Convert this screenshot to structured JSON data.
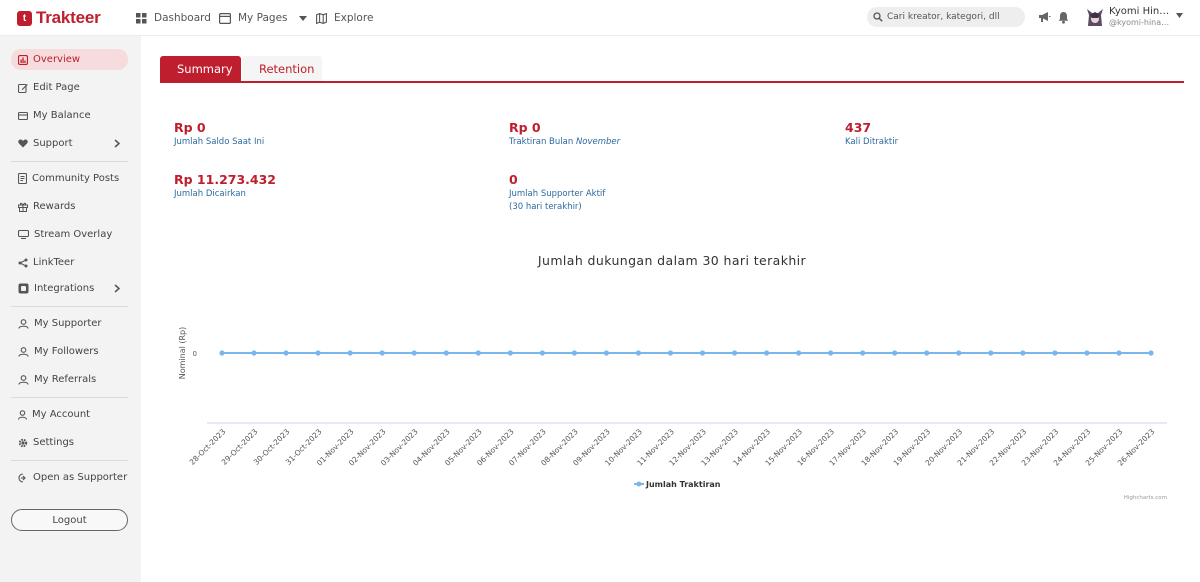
{
  "brand": {
    "name": "Trakteer",
    "color": "#be1e2d"
  },
  "topnav": {
    "dashboard": "Dashboard",
    "my_pages": "My Pages",
    "explore": "Explore",
    "search_placeholder": "Cari kreator, kategori, dll",
    "icons": [
      "megaphone-icon",
      "bell-icon"
    ],
    "user": {
      "name": "Kyomi Hinaga",
      "handle": "@kyomi-hinaga"
    }
  },
  "sidebar": {
    "items": [
      {
        "label": "Overview",
        "icon": "chart-bar-icon",
        "active": true
      },
      {
        "label": "Edit Page",
        "icon": "edit-icon"
      },
      {
        "label": "My Balance",
        "icon": "wallet-icon"
      },
      {
        "label": "Support",
        "icon": "heart-icon",
        "chevron": true
      },
      {
        "label": "Community Posts",
        "icon": "document-icon"
      },
      {
        "label": "Rewards",
        "icon": "gift-icon"
      },
      {
        "label": "Stream Overlay",
        "icon": "overlay-icon"
      },
      {
        "label": "LinkTeer",
        "icon": "share-icon"
      },
      {
        "label": "Integrations",
        "icon": "integrations-icon",
        "chevron": true
      },
      {
        "label": "My Supporter",
        "icon": "users-icon"
      },
      {
        "label": "My Followers",
        "icon": "users-icon"
      },
      {
        "label": "My Referrals",
        "icon": "users-icon"
      },
      {
        "label": "My Account",
        "icon": "user-icon"
      },
      {
        "label": "Settings",
        "icon": "gear-icon"
      },
      {
        "label": "Open as Supporter",
        "icon": "switch-icon"
      }
    ],
    "logout": "Logout"
  },
  "tabs": {
    "summary": "Summary",
    "retention": "Retention"
  },
  "stats": {
    "saldo": {
      "value": "Rp 0",
      "label": "Jumlah Saldo Saat Ini"
    },
    "traktiran": {
      "value": "Rp 0",
      "label": "Traktiran Bulan",
      "month": "November"
    },
    "ditraktir": {
      "value": "437",
      "label": "Kali Ditraktir"
    },
    "dicairkan": {
      "value": "Rp 11.273.432",
      "label": "Jumlah Dicairkan"
    },
    "supporter": {
      "value": "0",
      "label": "Jumlah Supporter Aktif",
      "sublabel": "(30 hari terakhir)"
    }
  },
  "chart_data": {
    "type": "line",
    "title": "Jumlah dukungan dalam 30 hari terakhir",
    "ylabel": "Nominal (Rp)",
    "xlabel": "",
    "yticks": [
      "0"
    ],
    "categories": [
      "28-Oct-2023",
      "29-Oct-2023",
      "30-Oct-2023",
      "31-Oct-2023",
      "01-Nov-2023",
      "02-Nov-2023",
      "03-Nov-2023",
      "04-Nov-2023",
      "05-Nov-2023",
      "06-Nov-2023",
      "07-Nov-2023",
      "08-Nov-2023",
      "09-Nov-2023",
      "10-Nov-2023",
      "11-Nov-2023",
      "12-Nov-2023",
      "13-Nov-2023",
      "14-Nov-2023",
      "15-Nov-2023",
      "16-Nov-2023",
      "17-Nov-2023",
      "18-Nov-2023",
      "19-Nov-2023",
      "20-Nov-2023",
      "21-Nov-2023",
      "22-Nov-2023",
      "23-Nov-2023",
      "24-Nov-2023",
      "25-Nov-2023",
      "26-Nov-2023"
    ],
    "series": [
      {
        "name": "Jumlah Traktiran",
        "color": "#7cb5ec",
        "values": [
          0,
          0,
          0,
          0,
          0,
          0,
          0,
          0,
          0,
          0,
          0,
          0,
          0,
          0,
          0,
          0,
          0,
          0,
          0,
          0,
          0,
          0,
          0,
          0,
          0,
          0,
          0,
          0,
          0,
          0
        ]
      }
    ],
    "legend": "bottom-center",
    "grid": false,
    "credit": "Highcharts.com"
  }
}
